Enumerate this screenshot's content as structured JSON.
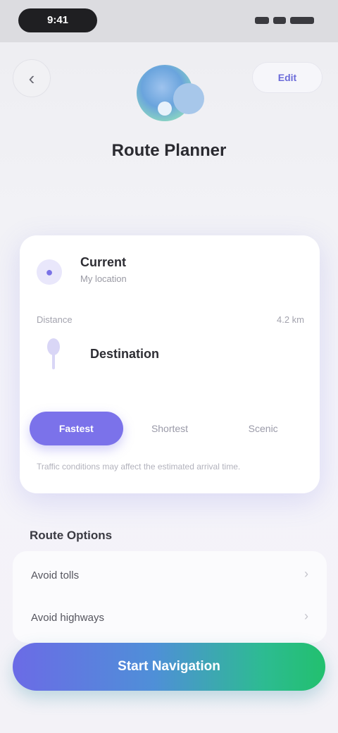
{
  "status_bar": {
    "time": "9:41"
  },
  "header": {
    "back_icon": "chevron-left-icon",
    "back_glyph": "‹",
    "action_label": "Edit",
    "title": "Route Planner"
  },
  "card": {
    "from": {
      "icon": "location-dot-icon",
      "glyph": "●",
      "label": "Current",
      "sublabel": "My location"
    },
    "divider": {
      "label": "Distance",
      "value": "4.2 km"
    },
    "to": {
      "icon": "map-pin-icon",
      "label": "Destination"
    },
    "segments": [
      {
        "label": "Fastest",
        "active": true
      },
      {
        "label": "Shortest",
        "active": false
      },
      {
        "label": "Scenic",
        "active": false
      }
    ],
    "note": "Traffic conditions may affect the estimated arrival time."
  },
  "options": {
    "title": "Route Options",
    "rows": [
      {
        "label": "Avoid tolls",
        "chevron": "›"
      },
      {
        "label": "Avoid highways",
        "chevron": "›"
      }
    ]
  },
  "cta": {
    "label": "Start Navigation"
  },
  "colors": {
    "accent": "#7b72ea",
    "cta_start": "#6b6be6",
    "cta_end": "#22c06e"
  }
}
